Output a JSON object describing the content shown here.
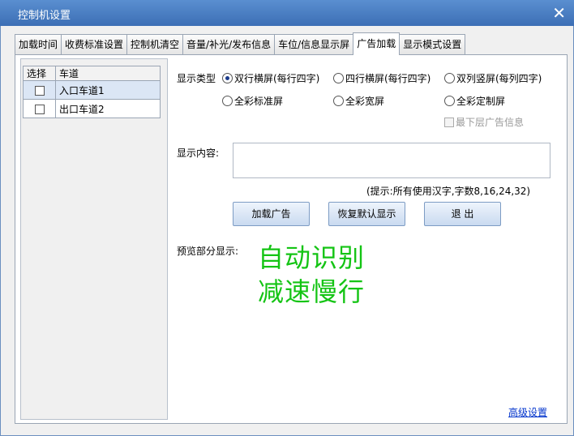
{
  "window": {
    "title": "控制机设置",
    "close_symbol": "✕"
  },
  "tabs": [
    {
      "label": "加载时间",
      "active": false
    },
    {
      "label": "收费标准设置",
      "active": false
    },
    {
      "label": "控制机清空",
      "active": false
    },
    {
      "label": "音量/补光/发布信息",
      "active": false
    },
    {
      "label": "车位/信息显示屏",
      "active": false
    },
    {
      "label": "广告加载",
      "active": true
    },
    {
      "label": "显示模式设置",
      "active": false
    }
  ],
  "lanes": {
    "headers": {
      "select": "选择",
      "lane": "车道"
    },
    "rows": [
      {
        "name": "入口车道1",
        "checked": false,
        "selected": true
      },
      {
        "name": "出口车道2",
        "checked": false,
        "selected": false
      }
    ]
  },
  "display_type": {
    "label": "显示类型",
    "options": [
      {
        "label": "双行横屏(每行四字)",
        "selected": true
      },
      {
        "label": "四行横屏(每行四字)",
        "selected": false
      },
      {
        "label": "双列竖屏(每列四字)",
        "selected": false
      },
      {
        "label": "全彩标准屏",
        "selected": false
      },
      {
        "label": "全彩宽屏",
        "selected": false
      },
      {
        "label": "全彩定制屏",
        "selected": false
      }
    ],
    "bottom_ad_label": "最下层广告信息",
    "bottom_ad_enabled": false
  },
  "content": {
    "label": "显示内容:",
    "value": "",
    "hint": "(提示:所有使用汉字,字数8,16,24,32)"
  },
  "buttons": {
    "load_ad": "加载广告",
    "restore_default": "恢复默认显示",
    "exit": "退  出"
  },
  "preview": {
    "label": "预览部分显示:",
    "line1": "自动识别",
    "line2": "减速慢行",
    "color": "#14c414"
  },
  "advanced_link": "高级设置"
}
